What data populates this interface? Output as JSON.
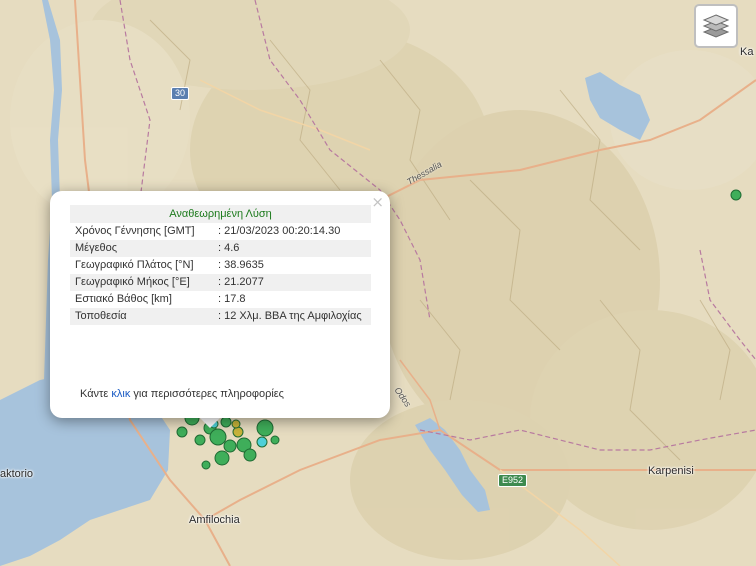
{
  "map": {
    "places": [
      {
        "name": "Amfilochia"
      },
      {
        "name": "Karpenisi"
      },
      {
        "name": "aktorio"
      },
      {
        "name": "Ka"
      }
    ],
    "roads": [
      {
        "shield": "30"
      },
      {
        "shield": "E952"
      },
      {
        "name": "Thessalia"
      },
      {
        "name": "Odos"
      }
    ],
    "colors": {
      "land": "#e6dcc0",
      "water": "#a7c3dc",
      "quake_green": "#3fae5a",
      "quake_cyan": "#4fd0d8",
      "quake_yellow": "#c8b43a"
    }
  },
  "controls": {
    "layers_icon": "layers-icon"
  },
  "popup": {
    "header": "Αναθεωρημένη Λύση",
    "rows": [
      {
        "label": "Χρόνος Γέννησης [GMT]",
        "value": ": 21/03/2023 00:20:14.30"
      },
      {
        "label": "Μέγεθος",
        "value": ": 4.6"
      },
      {
        "label": "Γεωγραφικό Πλάτος [°N]",
        "value": ": 38.9635"
      },
      {
        "label": "Γεωγραφικό Μήκος [°E]",
        "value": ": 21.2077"
      },
      {
        "label": "Εστιακό Βάθος [km]",
        "value": ": 17.8"
      },
      {
        "label": "Τοποθεσία",
        "value": ": 12 Χλμ. ΒΒΑ της Αμφιλοχίας"
      }
    ],
    "footer_prefix": "Κάντε ",
    "footer_link": "κλικ",
    "footer_suffix": " για περισσότερες πληροφορίες",
    "close_symbol": "×"
  }
}
